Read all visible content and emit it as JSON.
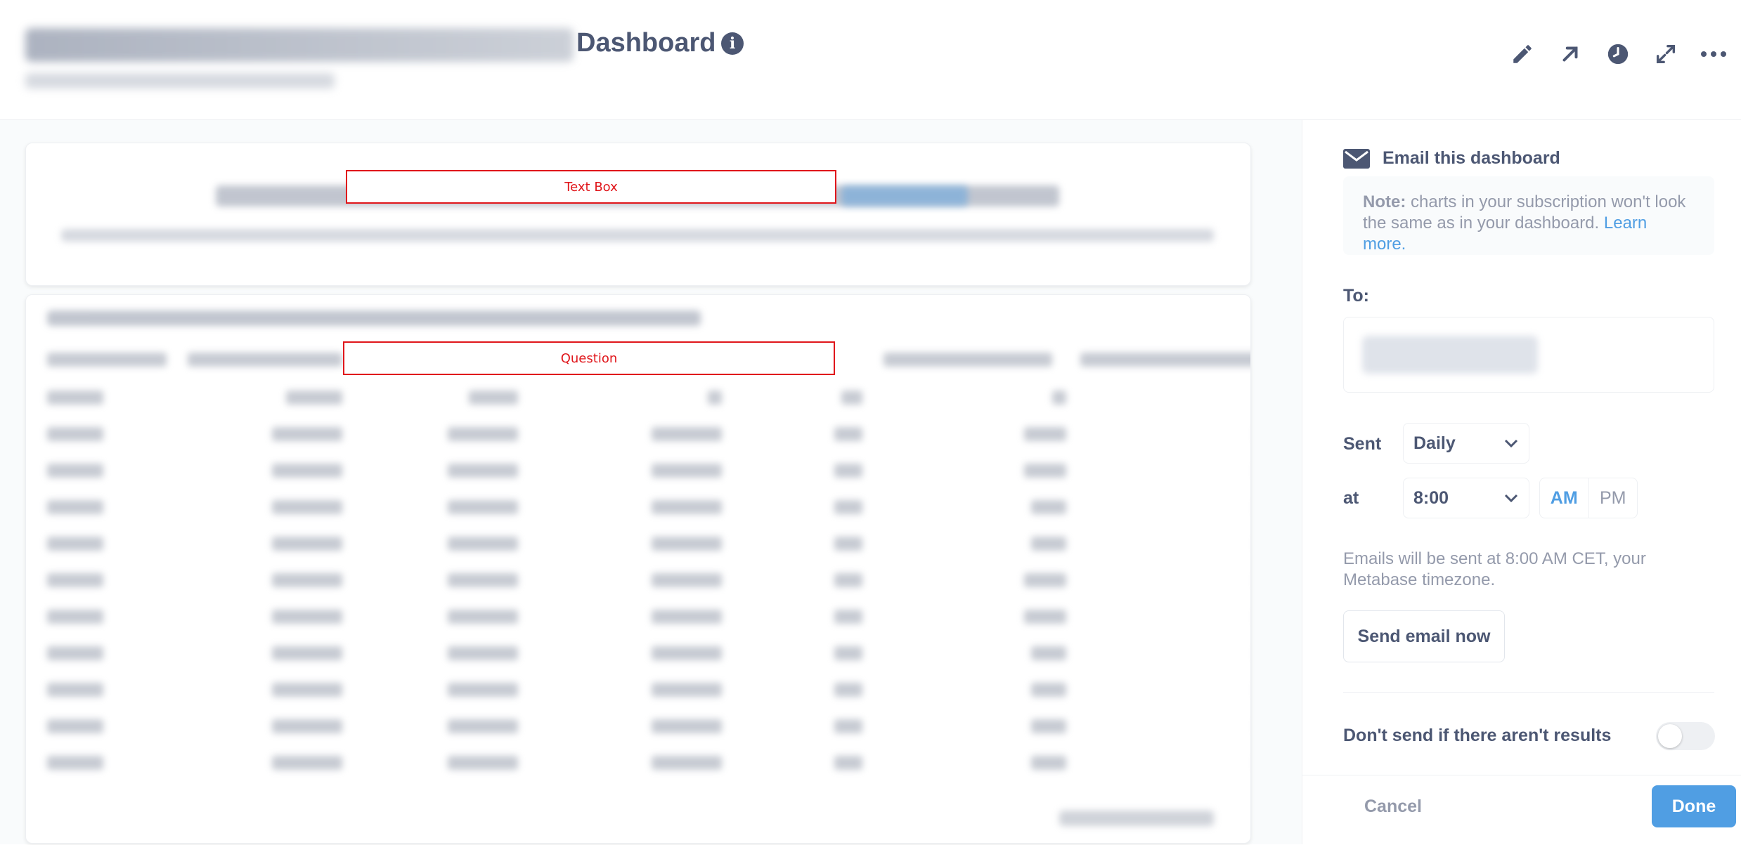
{
  "header": {
    "title_suffix": "Dashboard",
    "actions": [
      "pencil-icon",
      "arrow-up-right-icon",
      "clock-icon",
      "expand-icon",
      "more-icon"
    ]
  },
  "main": {
    "text_card_label": "Text Box",
    "question_card_label": "Question"
  },
  "sidebar": {
    "heading": "Email this dashboard",
    "note": {
      "bold": "Note:",
      "text": " charts in your subscription won't look the same as in your dashboard. ",
      "link": "Learn more."
    },
    "to_label": "To:",
    "sent_label": "Sent",
    "frequency": "Daily",
    "at_label": "at",
    "time": "8:00",
    "am": "AM",
    "pm": "PM",
    "hint": "Emails will be sent at 8:00 AM CET, your Metabase timezone.",
    "send_now": "Send email now",
    "dont_send_label": "Don't send if there aren't results",
    "cancel": "Cancel",
    "done": "Done"
  },
  "colors": {
    "brand": "#509ee3",
    "text_dark": "#4c5773",
    "text_light": "#949aab",
    "annotation_red": "#e0161b"
  }
}
